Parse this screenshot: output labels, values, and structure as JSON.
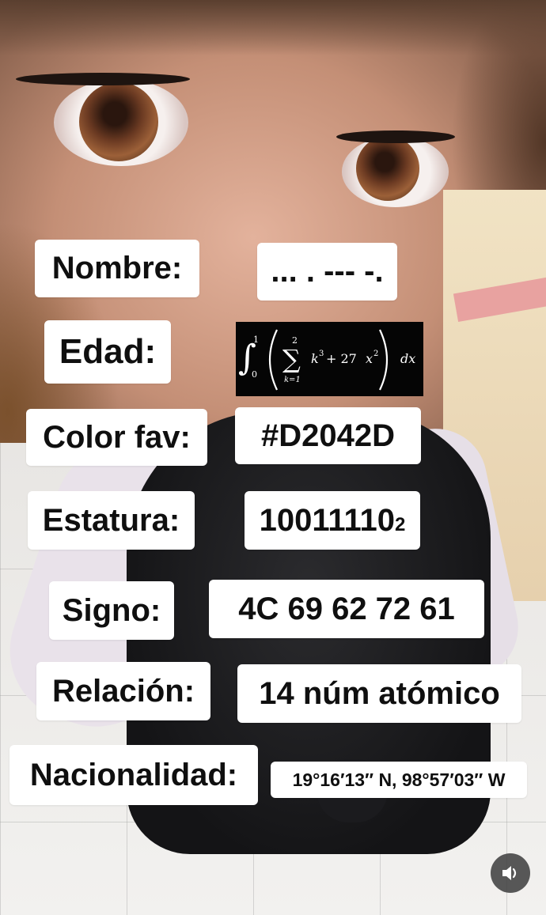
{
  "card": {
    "nombre_label": "Nombre:",
    "nombre_value": "... . --- -.",
    "edad_label": "Edad:",
    "edad_formula": {
      "integral_upper": "1",
      "integral_lower": "0",
      "sum_upper": "2",
      "sum_lower": "k=1",
      "k": "k",
      "k_exp": "3",
      "middle": "+ 27",
      "x": "x",
      "x_exp": "2",
      "dx": "dx"
    },
    "color_label": "Color fav:",
    "color_value": "#D2042D",
    "estatura_label": "Estatura:",
    "estatura_value": "10011110",
    "estatura_base": "2",
    "signo_label": "Signo:",
    "signo_value": "4C 69 62 72 61",
    "relacion_label": "Relación:",
    "relacion_value": "14 núm atómico",
    "nacionalidad_label": "Nacionalidad:",
    "nacionalidad_value": "19°16′13″ N, 98°57′03″ W"
  },
  "controls": {
    "sound_icon": "speaker-icon"
  }
}
